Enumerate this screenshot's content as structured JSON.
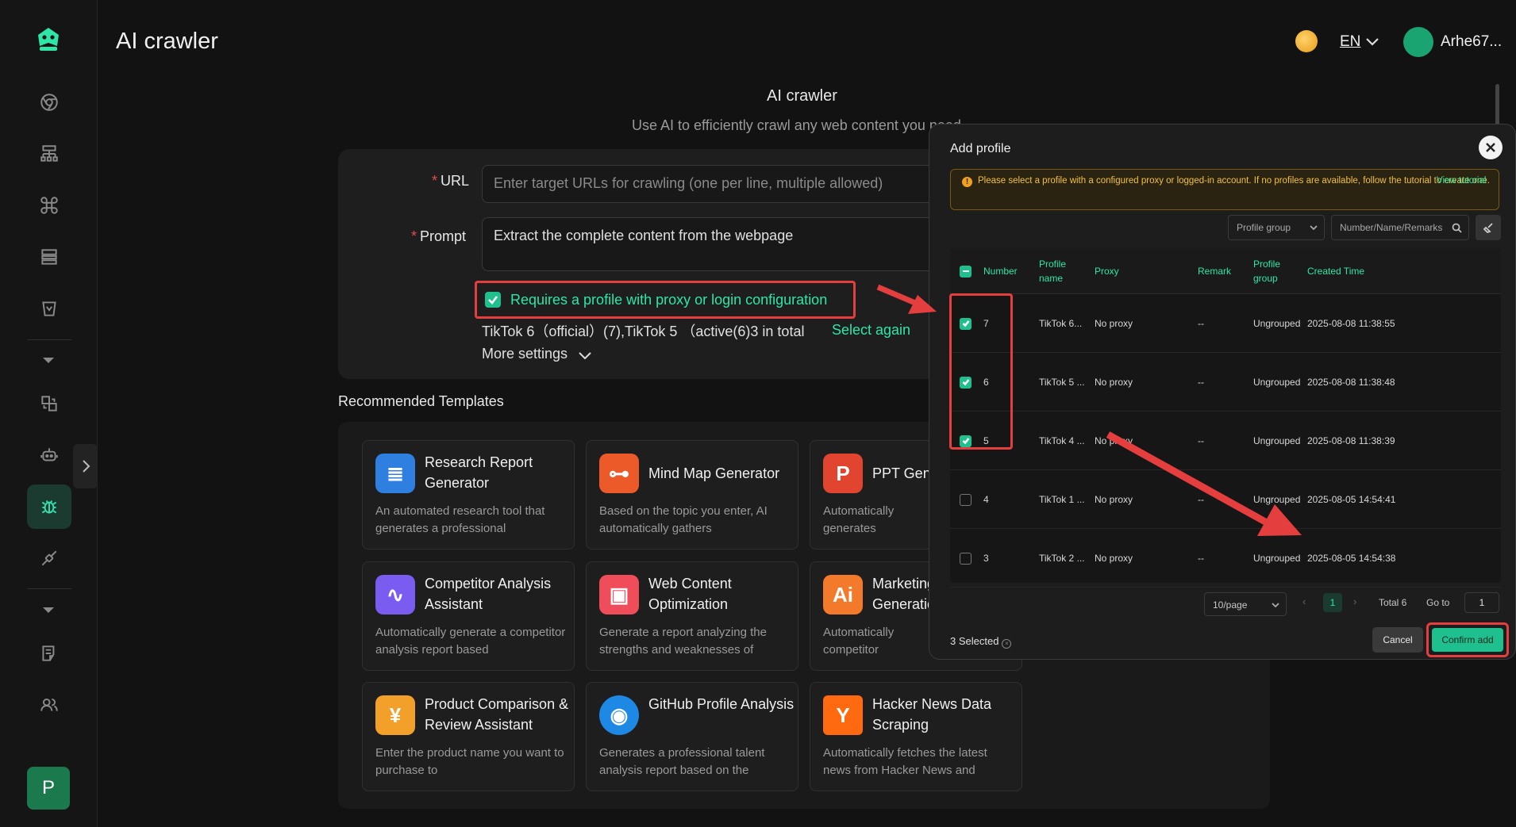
{
  "app": {
    "page_title": "AI crawler"
  },
  "header": {
    "language": "EN",
    "username": "Arhe67..."
  },
  "sidebar": {
    "avatar_letter": "P"
  },
  "intro": {
    "title": "AI crawler",
    "subtitle": "Use AI to efficiently crawl any web content you need"
  },
  "form": {
    "url_label": "URL",
    "url_placeholder": "Enter target URLs for crawling (one per line, multiple allowed)",
    "prompt_label": "Prompt",
    "prompt_value": "Extract the complete content from the webpage",
    "checkbox_label": "Requires a profile with proxy or login configuration",
    "selected_profiles": "TikTok 6（official）(7),TikTok 5 （active(6)3 in total",
    "select_again": "Select again",
    "more_settings": "More settings"
  },
  "templates": {
    "title": "Recommended Templates",
    "cards": [
      {
        "title": "Research Report Generator",
        "desc": "An automated research tool that generates a professional",
        "icon": "document-icon",
        "color": "#2f7fe0"
      },
      {
        "title": "Mind Map Generator",
        "desc": "Based on the topic you enter, AI automatically gathers",
        "icon": "mindmap-icon",
        "color": "#ec5a2a"
      },
      {
        "title": "PPT Generator",
        "desc": "Automatically generates professional, presentation",
        "icon": "ppt-icon",
        "color": "#e2452f"
      },
      {
        "title": "Competitor Analysis Assistant",
        "desc": "Automatically generate a competitor analysis report based",
        "icon": "chart-icon",
        "color": "#7a5cf0"
      },
      {
        "title": "Web Content Optimization",
        "desc": "Generate a report analyzing the strengths and weaknesses of",
        "icon": "box-icon",
        "color": "#ef4d5a"
      },
      {
        "title": "Marketing Generation",
        "desc": "Automatically competitor analysis, marketing",
        "icon": "ai-doc-icon",
        "color": "#f27a2a"
      },
      {
        "title": "Product Comparison & Review Assistant",
        "desc": "Enter the product name you want to purchase to",
        "icon": "yen-doc-icon",
        "color": "#f2a02a"
      },
      {
        "title": "GitHub Profile Analysis",
        "desc": "Generates a professional talent analysis report based on the",
        "icon": "github-icon",
        "color": "#1e88e5"
      },
      {
        "title": "Hacker News Data Scraping",
        "desc": "Automatically fetches the latest news from Hacker News and",
        "icon": "hacker-news-icon",
        "color": "#ff6a10"
      }
    ]
  },
  "modal": {
    "title": "Add profile",
    "alert_text": "Please select a profile with a configured proxy or logged-in account. If no profiles are available, follow the tutorial to create one.",
    "alert_link": "View tutorial",
    "group_placeholder": "Profile group",
    "search_placeholder": "Number/Name/Remarks",
    "columns": [
      "Number",
      "Profile name",
      "Proxy",
      "Remark",
      "Profile group",
      "Created Time"
    ],
    "rows": [
      {
        "checked": true,
        "number": "7",
        "name": "TikTok 6...",
        "proxy": "No proxy",
        "remark": "--",
        "group": "Ungrouped",
        "created": "2025-08-08 11:38:55"
      },
      {
        "checked": true,
        "number": "6",
        "name": "TikTok 5 ...",
        "proxy": "No proxy",
        "remark": "--",
        "group": "Ungrouped",
        "created": "2025-08-08 11:38:48"
      },
      {
        "checked": true,
        "number": "5",
        "name": "TikTok 4 ...",
        "proxy": "No proxy",
        "remark": "--",
        "group": "Ungrouped",
        "created": "2025-08-08 11:38:39"
      },
      {
        "checked": false,
        "number": "4",
        "name": "TikTok 1 ...",
        "proxy": "No proxy",
        "remark": "--",
        "group": "Ungrouped",
        "created": "2025-08-05 14:54:41"
      },
      {
        "checked": false,
        "number": "3",
        "name": "TikTok 2 ...",
        "proxy": "No proxy",
        "remark": "--",
        "group": "Ungrouped",
        "created": "2025-08-05 14:54:38"
      }
    ],
    "page_size": "10/page",
    "current_page": "1",
    "total": "Total 6",
    "goto_label": "Go to",
    "goto_value": "1",
    "selected_count": "3 Selected",
    "cancel": "Cancel",
    "confirm": "Confirm add"
  },
  "colors": {
    "accent": "#1fc08e",
    "highlight": "#e53e3e",
    "warning": "#f0c040"
  }
}
